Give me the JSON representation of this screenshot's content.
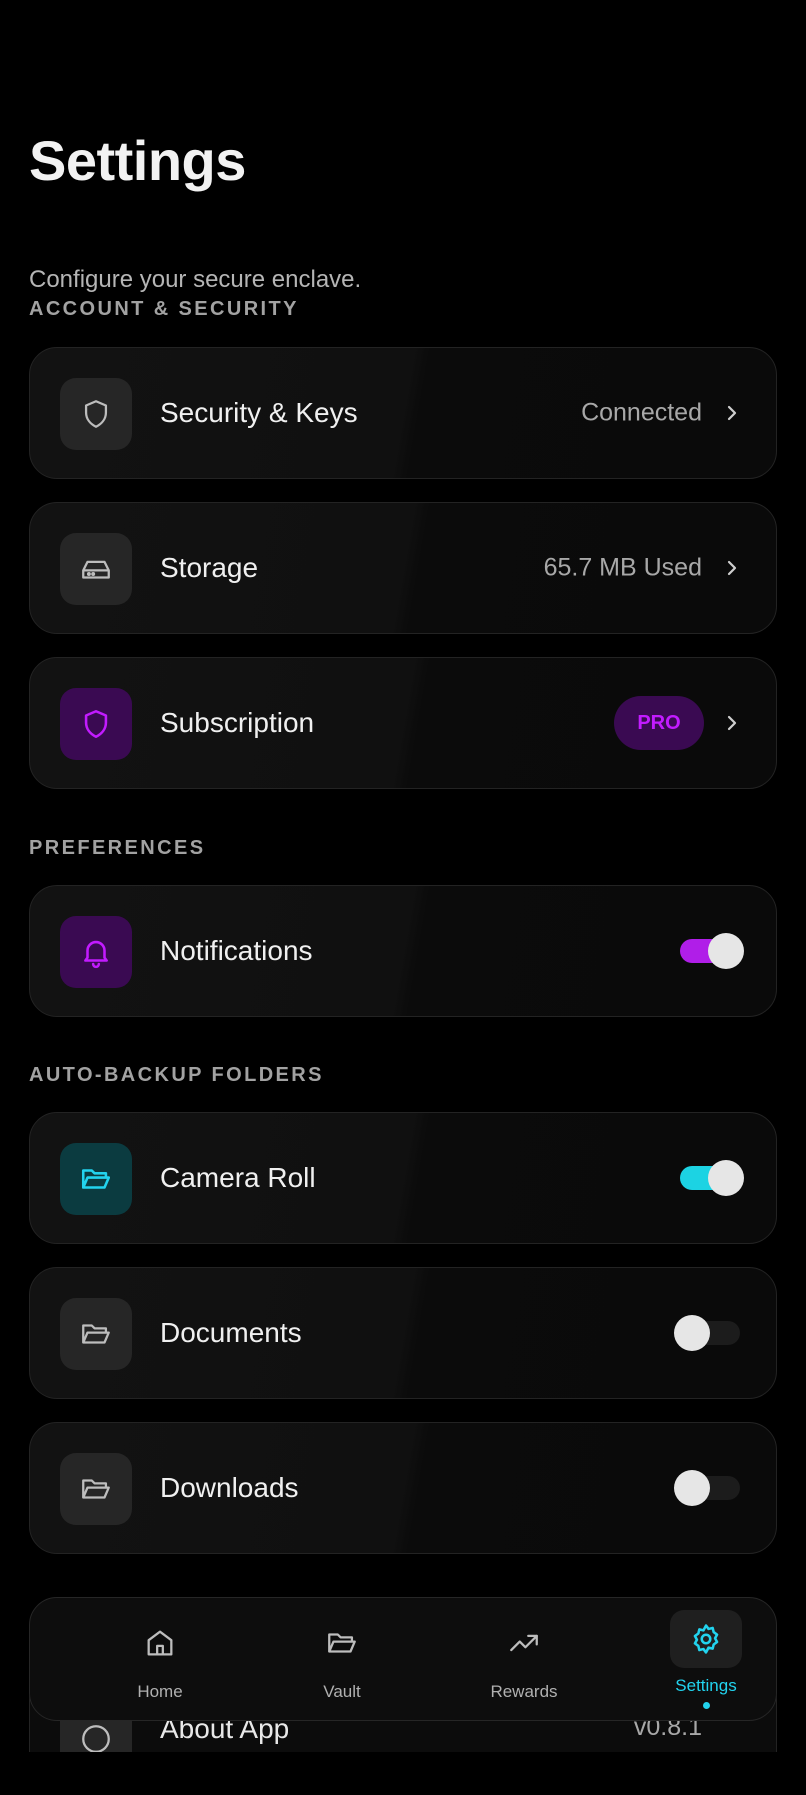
{
  "header": {
    "title": "Settings",
    "subtitle": "Configure your secure enclave."
  },
  "sections": {
    "account": "ACCOUNT & SECURITY",
    "preferences": "PREFERENCES",
    "backup": "AUTO-BACKUP FOLDERS"
  },
  "account_items": [
    {
      "label": "Security & Keys",
      "value": "Connected",
      "icon": "shield-icon"
    },
    {
      "label": "Storage",
      "value": "65.7 MB Used",
      "icon": "hard-drive-icon"
    },
    {
      "label": "Subscription",
      "badge": "PRO",
      "icon": "shield-icon"
    }
  ],
  "preferences_items": [
    {
      "label": "Notifications",
      "enabled": true,
      "icon": "bell-icon"
    }
  ],
  "backup_items": [
    {
      "label": "Camera Roll",
      "enabled": true,
      "icon": "folder-open-icon"
    },
    {
      "label": "Documents",
      "enabled": false,
      "icon": "folder-open-icon"
    },
    {
      "label": "Downloads",
      "enabled": false,
      "icon": "folder-open-icon"
    }
  ],
  "about": {
    "label": "About App",
    "value": "v0.8.1"
  },
  "nav": {
    "items": [
      {
        "label": "Home",
        "icon": "home-icon"
      },
      {
        "label": "Vault",
        "icon": "folder-icon"
      },
      {
        "label": "Rewards",
        "icon": "trending-up-icon"
      },
      {
        "label": "Settings",
        "icon": "gear-icon",
        "active": true
      }
    ]
  },
  "colors": {
    "accent_purple": "#c21bff",
    "accent_cyan": "#22d3ee",
    "background": "#000000"
  }
}
